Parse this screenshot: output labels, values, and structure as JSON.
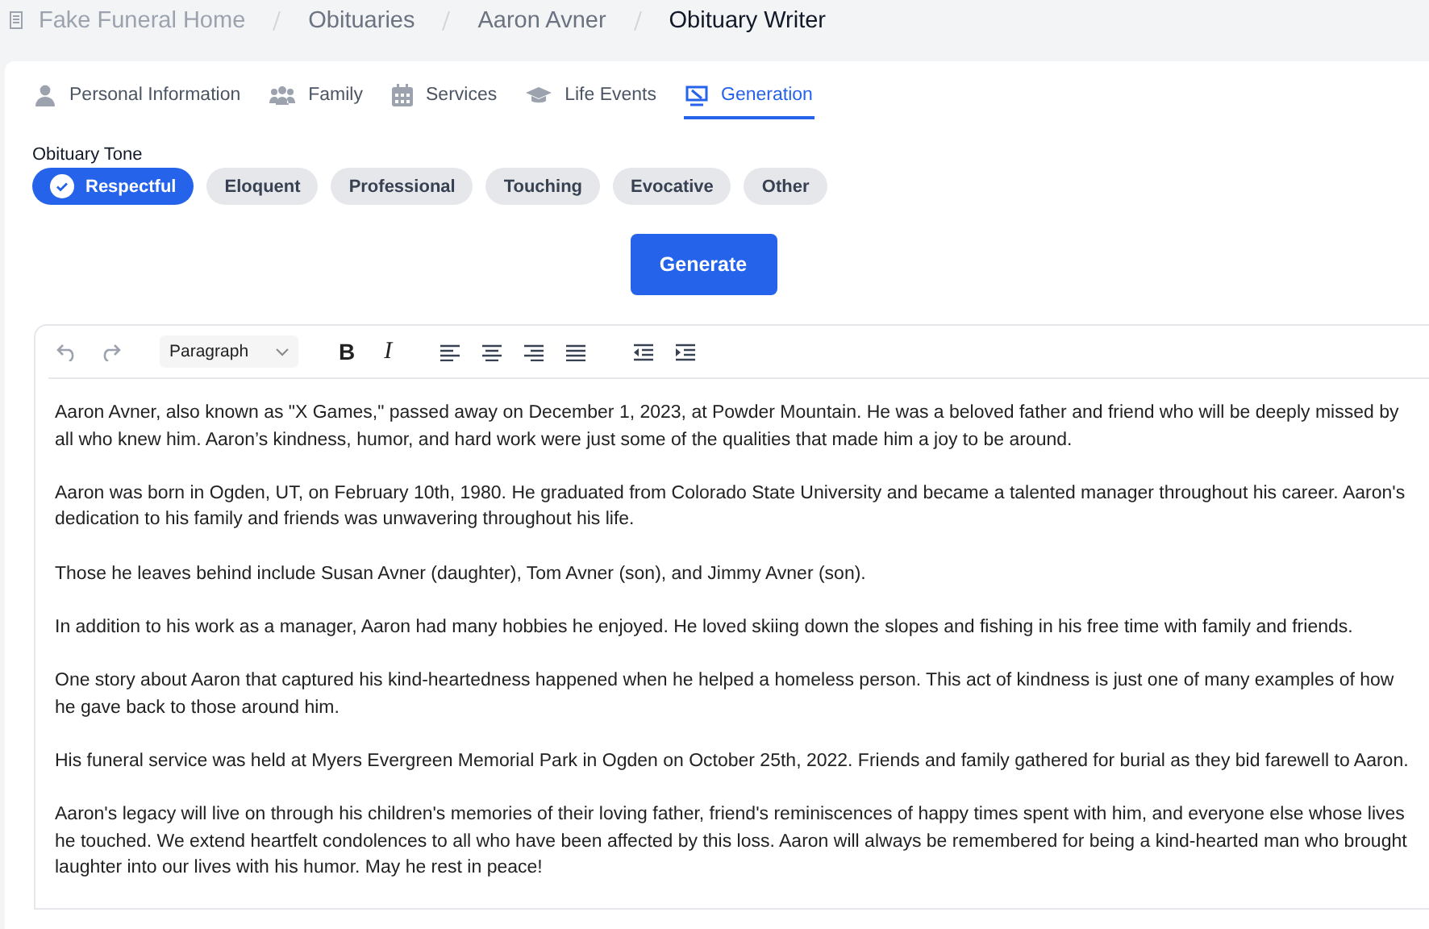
{
  "breadcrumb": [
    {
      "label": "Fake Funeral Home",
      "kind": "home"
    },
    {
      "label": "Obituaries",
      "kind": "link"
    },
    {
      "label": "Aaron Avner",
      "kind": "link"
    },
    {
      "label": "Obituary Writer",
      "kind": "current"
    }
  ],
  "tabs": [
    {
      "label": "Personal Information",
      "selected": false
    },
    {
      "label": "Family",
      "selected": false
    },
    {
      "label": "Services",
      "selected": false
    },
    {
      "label": "Life Events",
      "selected": false
    },
    {
      "label": "Generation",
      "selected": true
    }
  ],
  "tone": {
    "label": "Obituary Tone",
    "options": [
      {
        "label": "Respectful",
        "selected": true
      },
      {
        "label": "Eloquent",
        "selected": false
      },
      {
        "label": "Professional",
        "selected": false
      },
      {
        "label": "Touching",
        "selected": false
      },
      {
        "label": "Evocative",
        "selected": false
      },
      {
        "label": "Other",
        "selected": false
      }
    ]
  },
  "generate_button": "Generate",
  "editor": {
    "toolbar": {
      "block_format": "Paragraph",
      "bold": "B",
      "italic": "I"
    },
    "paragraphs": [
      "Aaron Avner, also known as \"X Games,\" passed away on December 1, 2023, at Powder Mountain. He was a beloved father and friend who will be deeply missed by all who knew him. Aaron’s kindness, humor, and hard work were just some of the qualities that made him a joy to be around.",
      "Aaron was born in Ogden, UT, on February 10th, 1980. He graduated from Colorado State University and became a talented manager throughout his career. Aaron's dedication to his family and friends was unwavering throughout his life.",
      "Those he leaves behind include Susan Avner (daughter), Tom Avner (son), and Jimmy Avner (son).",
      "In addition to his work as a manager, Aaron had many hobbies he enjoyed. He loved skiing down the slopes and fishing in his free time with family and friends.",
      "One story about Aaron that captured his kind-heartedness happened when he helped a homeless person. This act of kindness is just one of many examples of how he gave back to those around him.",
      "His funeral service was held at Myers Evergreen Memorial Park in Ogden on October 25th, 2022. Friends and family gathered for burial as they bid farewell to Aaron.",
      "Aaron's legacy will live on through his children's memories of their loving father, friend's reminiscences of happy times spent with him, and everyone else whose lives he touched. We extend heartfelt condolences to all who have been affected by this loss. Aaron will always be remembered for being a kind-hearted man who brought laughter into our lives with his humor. May he rest in peace!"
    ]
  }
}
